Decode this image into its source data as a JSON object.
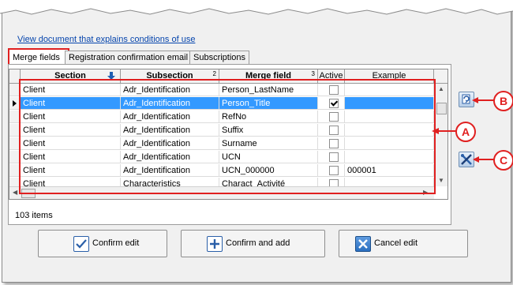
{
  "doc_link": "View document that explains conditions of use",
  "tabs": [
    {
      "label": "Merge fields"
    },
    {
      "label": "Registration confirmation email"
    },
    {
      "label": "Subscriptions"
    }
  ],
  "grid": {
    "columns": [
      {
        "label": "Section",
        "sort": "down-arrow-icon"
      },
      {
        "label": "Subsection",
        "num": "2"
      },
      {
        "label": "Merge field",
        "num": "3"
      },
      {
        "label": "Active"
      },
      {
        "label": "Example"
      }
    ],
    "rows": [
      {
        "section": "Client",
        "subsection": "Adr_Identification",
        "merge_field": "Person_LastName",
        "active": false,
        "example": ""
      },
      {
        "section": "Client",
        "subsection": "Adr_Identification",
        "merge_field": "Person_Title",
        "active": true,
        "example": ""
      },
      {
        "section": "Client",
        "subsection": "Adr_Identification",
        "merge_field": "RefNo",
        "active": false,
        "example": ""
      },
      {
        "section": "Client",
        "subsection": "Adr_Identification",
        "merge_field": "Suffix",
        "active": false,
        "example": ""
      },
      {
        "section": "Client",
        "subsection": "Adr_Identification",
        "merge_field": "Surname",
        "active": false,
        "example": ""
      },
      {
        "section": "Client",
        "subsection": "Adr_Identification",
        "merge_field": "UCN",
        "active": false,
        "example": ""
      },
      {
        "section": "Client",
        "subsection": "Adr_Identification",
        "merge_field": "UCN_000000",
        "active": false,
        "example": "000001"
      },
      {
        "section": "Client",
        "subsection": "Characteristics",
        "merge_field": "Charact_Activité",
        "active": false,
        "example": ""
      }
    ]
  },
  "item_count": "103 items",
  "buttons": {
    "confirm_edit": "Confirm edit",
    "confirm_add": "Confirm and add",
    "cancel_edit": "Cancel edit"
  },
  "callouts": {
    "a": "A",
    "b": "B",
    "c": "C"
  },
  "colors": {
    "selection": "#3399ff",
    "annotation": "#e02020",
    "link": "#0645ad"
  }
}
